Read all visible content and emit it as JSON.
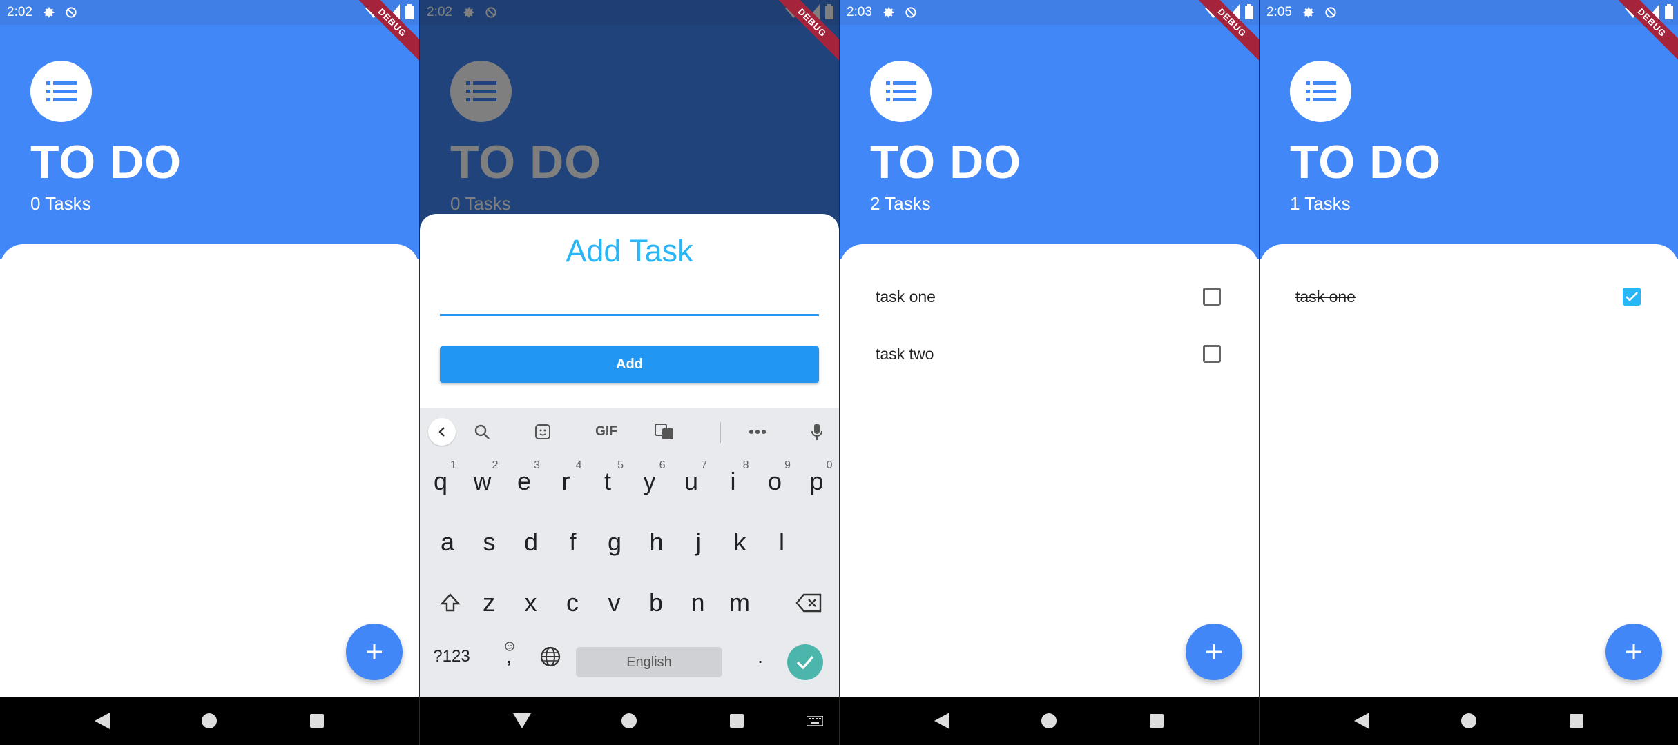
{
  "colors": {
    "primary": "#4287f8",
    "status_bar": "#3f7fe6",
    "accent": "#29b6f6",
    "button": "#2196f3",
    "debug_ribbon": "#a5243c"
  },
  "screens": [
    {
      "time": "2:02",
      "title": "TO DO",
      "task_count": "0 Tasks",
      "debug_label": "DEBUG",
      "tasks": []
    },
    {
      "time": "2:02",
      "title": "TO DO",
      "task_count": "0 Tasks",
      "debug_label": "DEBUG",
      "sheet": {
        "title": "Add Task",
        "input_value": "",
        "button_label": "Add"
      },
      "keyboard": {
        "toolbar_gif": "GIF",
        "row1": [
          {
            "key": "q",
            "hint": "1"
          },
          {
            "key": "w",
            "hint": "2"
          },
          {
            "key": "e",
            "hint": "3"
          },
          {
            "key": "r",
            "hint": "4"
          },
          {
            "key": "t",
            "hint": "5"
          },
          {
            "key": "y",
            "hint": "6"
          },
          {
            "key": "u",
            "hint": "7"
          },
          {
            "key": "i",
            "hint": "8"
          },
          {
            "key": "o",
            "hint": "9"
          },
          {
            "key": "p",
            "hint": "0"
          }
        ],
        "row2": [
          "a",
          "s",
          "d",
          "f",
          "g",
          "h",
          "j",
          "k",
          "l"
        ],
        "row3": [
          "z",
          "x",
          "c",
          "v",
          "b",
          "n",
          "m"
        ],
        "symbols_key": "?123",
        "comma_key": ",",
        "period_key": ".",
        "space_label": "English"
      }
    },
    {
      "time": "2:03",
      "title": "TO DO",
      "task_count": "2 Tasks",
      "debug_label": "DEBUG",
      "tasks": [
        {
          "label": "task one",
          "done": false
        },
        {
          "label": "task two",
          "done": false
        }
      ]
    },
    {
      "time": "2:05",
      "title": "TO DO",
      "task_count": "1 Tasks",
      "debug_label": "DEBUG",
      "tasks": [
        {
          "label": "task one",
          "done": true
        }
      ]
    }
  ],
  "icons": {
    "status_settings": "gear-icon",
    "status_sync": "no-sync-icon",
    "status_wifi": "wifi-icon",
    "status_signal": "signal-icon",
    "status_battery": "battery-icon",
    "logo": "list-icon",
    "fab": "add-icon",
    "nav_back": "back-triangle-icon",
    "nav_home": "home-circle-icon",
    "nav_recent": "recent-square-icon"
  }
}
